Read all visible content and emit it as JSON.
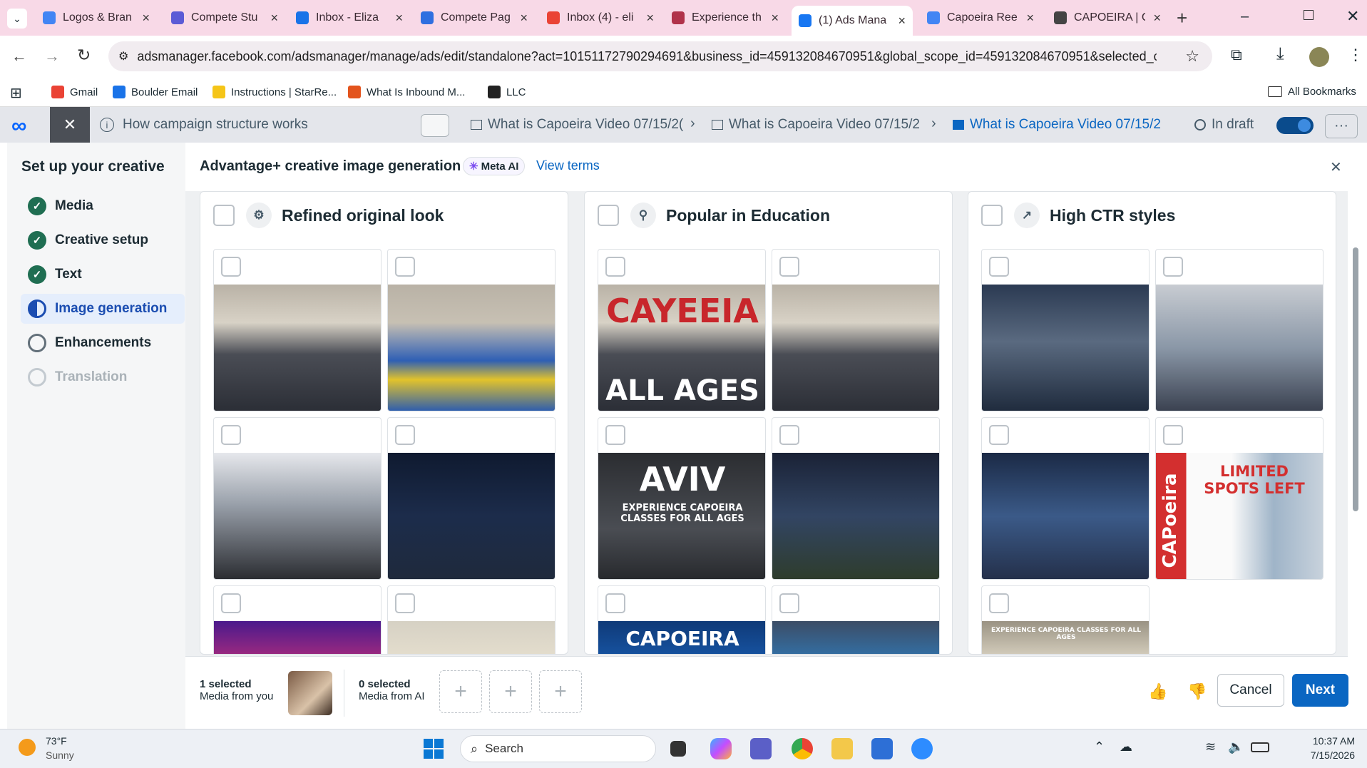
{
  "browser": {
    "tabs": [
      {
        "title": "Logos & Bran",
        "favicon_color": "#4285f4",
        "icon": "google-drive-icon"
      },
      {
        "title": "Compete Stu",
        "favicon_color": "#5b5bd6",
        "icon": "compete-icon"
      },
      {
        "title": "Inbox - Eliza",
        "favicon_color": "#1a73e8",
        "icon": "outlook-icon"
      },
      {
        "title": "Compete Pag",
        "favicon_color": "#2f6fe0",
        "icon": "compete-icon"
      },
      {
        "title": "Inbox (4) - eli",
        "favicon_color": "#ea4335",
        "icon": "gmail-icon"
      },
      {
        "title": "Experience th",
        "favicon_color": "#b0324a",
        "icon": "site-icon"
      },
      {
        "title": "(1) Ads Mana",
        "favicon_color": "#1877f2",
        "icon": "meta-icon",
        "active": true
      },
      {
        "title": "Capoeira Ree",
        "favicon_color": "#4285f4",
        "icon": "docs-icon"
      },
      {
        "title": "CAPOEIRA | C",
        "favicon_color": "#444444",
        "icon": "site-icon"
      }
    ],
    "new_tab_glyph": "+",
    "url": "adsmanager.facebook.com/adsmanager/manage/ads/edit/standalone?act=10151172790294691&business_id=459132084670951&global_scope_id=459132084670951&selected_campai...",
    "bookmarks": [
      {
        "label": "Gmail",
        "icon": "gmail-icon"
      },
      {
        "label": "Boulder Email",
        "icon": "outlook-icon"
      },
      {
        "label": "Instructions | StarRe...",
        "icon": "star-icon"
      },
      {
        "label": "What Is Inbound M...",
        "icon": "hubspot-icon"
      },
      {
        "label": "LLC",
        "icon": "lz-icon"
      }
    ],
    "all_bookmarks": "All Bookmarks"
  },
  "ads_manager": {
    "help_link": "How campaign structure works",
    "breadcrumbs": [
      {
        "label": "What is Capoeira Video 07/15/2(",
        "icon": "folder-icon"
      },
      {
        "label": "What is Capoeira Video 07/15/2",
        "icon": "grid-icon"
      },
      {
        "label": "What is Capoeira Video 07/15/2",
        "icon": "ad-icon",
        "active": true
      }
    ],
    "status": "In draft"
  },
  "sidebar": {
    "title": "Set up your creative",
    "steps": [
      {
        "label": "Media",
        "state": "done"
      },
      {
        "label": "Creative setup",
        "state": "done"
      },
      {
        "label": "Text",
        "state": "done"
      },
      {
        "label": "Image generation",
        "state": "current"
      },
      {
        "label": "Enhancements",
        "state": "todo"
      },
      {
        "label": "Translation",
        "state": "disabled"
      }
    ]
  },
  "header": {
    "title": "Advantage+ creative image generation",
    "badge": "Meta AI",
    "view_terms": "View terms"
  },
  "columns": [
    {
      "title": "Refined original look",
      "icon": "sparkle-settings-icon",
      "images": [
        {
          "desc": "gym-circle",
          "overlay": ""
        },
        {
          "desc": "mat-circle",
          "overlay": ""
        },
        {
          "desc": "stage-bw",
          "overlay": ""
        },
        {
          "desc": "dark-stage",
          "overlay": ""
        },
        {
          "desc": "concert",
          "overlay": ""
        },
        {
          "desc": "studio",
          "overlay": ""
        }
      ]
    },
    {
      "title": "Popular in Education",
      "icon": "people-icon",
      "images": [
        {
          "desc": "gym-circle",
          "overlay_top": "CAYEEIA",
          "overlay": "ALL AGES"
        },
        {
          "desc": "gym-circle",
          "overlay": ""
        },
        {
          "desc": "grey-promo",
          "overlay_top": "AVIV",
          "overlay": "EXPERIENCE CAPOEIRA\nCLASSES FOR ALL AGES"
        },
        {
          "desc": "legs",
          "overlay": ""
        },
        {
          "desc": "blue-promo",
          "overlay": "CAPOEIRA"
        },
        {
          "desc": "gym-blue",
          "overlay": ""
        }
      ]
    },
    {
      "title": "High CTR styles",
      "icon": "trend-up-icon",
      "images": [
        {
          "desc": "smoke-solo",
          "overlay": ""
        },
        {
          "desc": "gym-smile",
          "overlay": ""
        },
        {
          "desc": "blue-fighter",
          "overlay": ""
        },
        {
          "desc": "red-promo",
          "overlay_top": "LIMITED\nSPOTS LEFT",
          "overlay": "CAPoeira"
        },
        {
          "desc": "banner",
          "overlay": "EXPERIENCE CAPOEIRA CLASSES FOR ALL AGES"
        }
      ]
    }
  ],
  "bottom": {
    "media_count": "1 selected",
    "media_label": "Media from you",
    "ai_count": "0 selected",
    "ai_label": "Media from AI",
    "slot_glyph": "+",
    "cancel": "Cancel",
    "next": "Next"
  },
  "taskbar": {
    "temp": "73°F",
    "weather": "Sunny",
    "search": "Search",
    "time": "10:37 AM",
    "date": "7/15/2026"
  }
}
